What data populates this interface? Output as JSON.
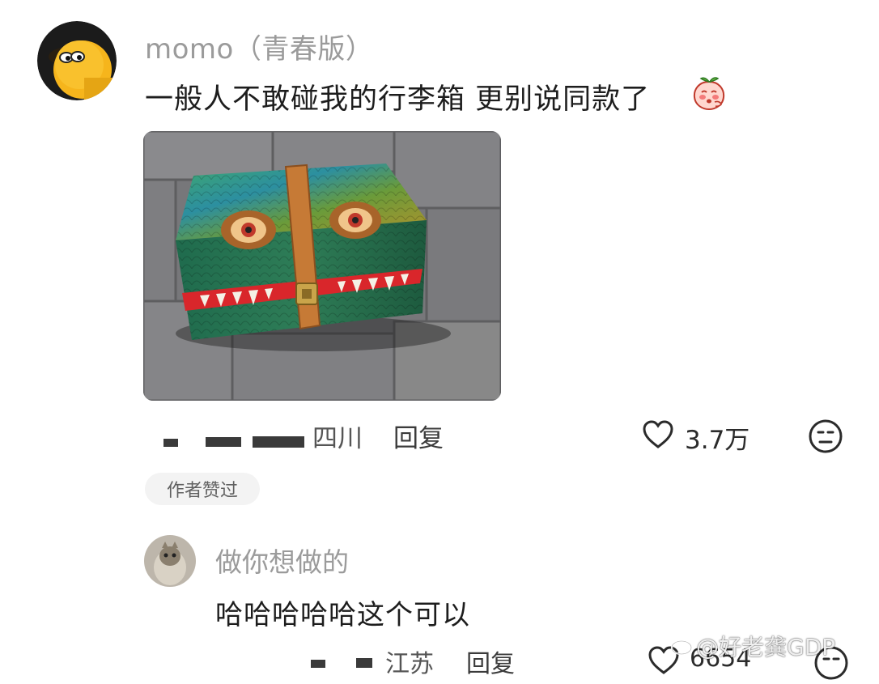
{
  "main_comment": {
    "username": "momo（青春版）",
    "text": "一般人不敢碰我的行李箱  更别说同款了",
    "emoji_icon": "peach-face-emoji",
    "location": "四川",
    "reply_label": "回复",
    "like_count": "3.7万",
    "author_badge": "作者赞过"
  },
  "reply_comment": {
    "username": "做你想做的",
    "text": "哈哈哈哈哈这个可以",
    "location": "江苏",
    "reply_label": "回复",
    "like_count": "6654"
  },
  "watermark": {
    "text": "@好老龚GDP"
  },
  "colors": {
    "username_gray": "#9b9b9b",
    "badge_bg": "#f3f3f3",
    "text_dark": "#1d1d1d"
  }
}
